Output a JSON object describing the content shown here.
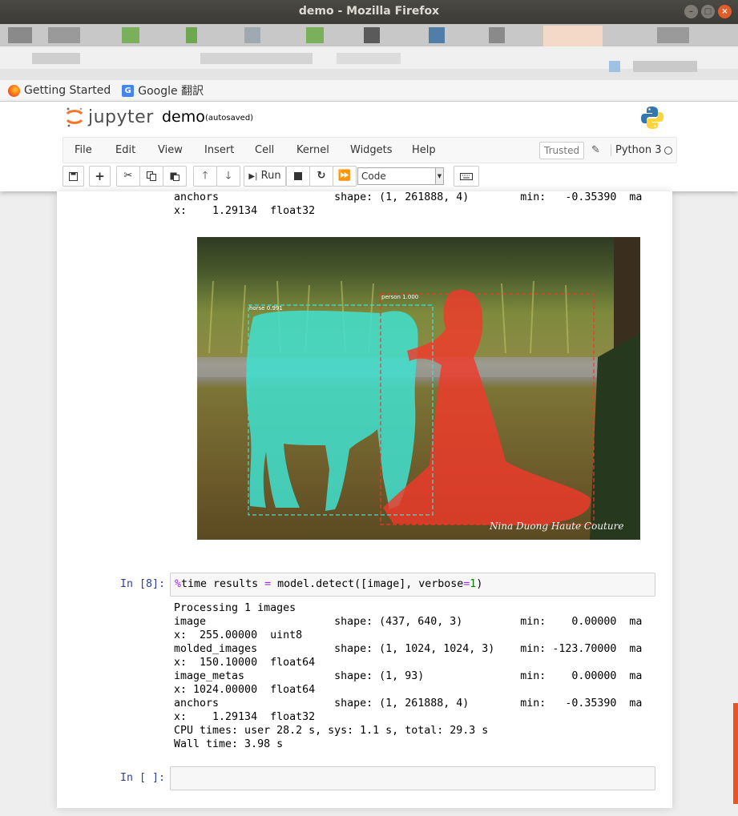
{
  "window": {
    "title": "demo - Mozilla Firefox",
    "minimize_glyph": "–",
    "maximize_glyph": "□",
    "close_glyph": "×"
  },
  "bookmarks": [
    {
      "label": "Getting Started",
      "icon": "firefox-icon"
    },
    {
      "label": "Google 翻訳",
      "icon": "google-translate-icon"
    }
  ],
  "jupyter": {
    "logo_text": "jupyter",
    "notebook_name": "demo",
    "autosave": "(autosaved)",
    "menu": [
      "File",
      "Edit",
      "View",
      "Insert",
      "Cell",
      "Kernel",
      "Widgets",
      "Help"
    ],
    "trusted": "Trusted",
    "kernel": "Python 3",
    "toolbar": {
      "run_label": "Run",
      "cell_type": "Code"
    }
  },
  "output_top": {
    "lines": [
      "anchors                  shape: (1, 261888, 4)        min:   -0.35390  ma",
      "x:    1.29134  float32"
    ]
  },
  "figure": {
    "labels": [
      {
        "text": "horse 0.991"
      },
      {
        "text": "person 1.000"
      }
    ],
    "watermark": "Nina Duong Haute Couture",
    "colors": {
      "horse": "#40e0d0",
      "person": "#f0392b"
    }
  },
  "cell8": {
    "prompt": "In [8]:",
    "code": {
      "magic": "%",
      "cmd": "time results ",
      "eq": "=",
      "rest": " model.detect([image], verbose",
      "eq2": "=",
      "num": "1",
      "close": ")"
    },
    "output": [
      "Processing 1 images",
      "image                    shape: (437, 640, 3)         min:    0.00000  ma",
      "x:  255.00000  uint8",
      "molded_images            shape: (1, 1024, 1024, 3)    min: -123.70000  ma",
      "x:  150.10000  float64",
      "image_metas              shape: (1, 93)               min:    0.00000  ma",
      "x: 1024.00000  float64",
      "anchors                  shape: (1, 261888, 4)        min:   -0.35390  ma",
      "x:    1.29134  float32",
      "CPU times: user 28.2 s, sys: 1.1 s, total: 29.3 s",
      "Wall time: 3.98 s"
    ]
  },
  "cell_empty": {
    "prompt": "In [ ]:"
  }
}
